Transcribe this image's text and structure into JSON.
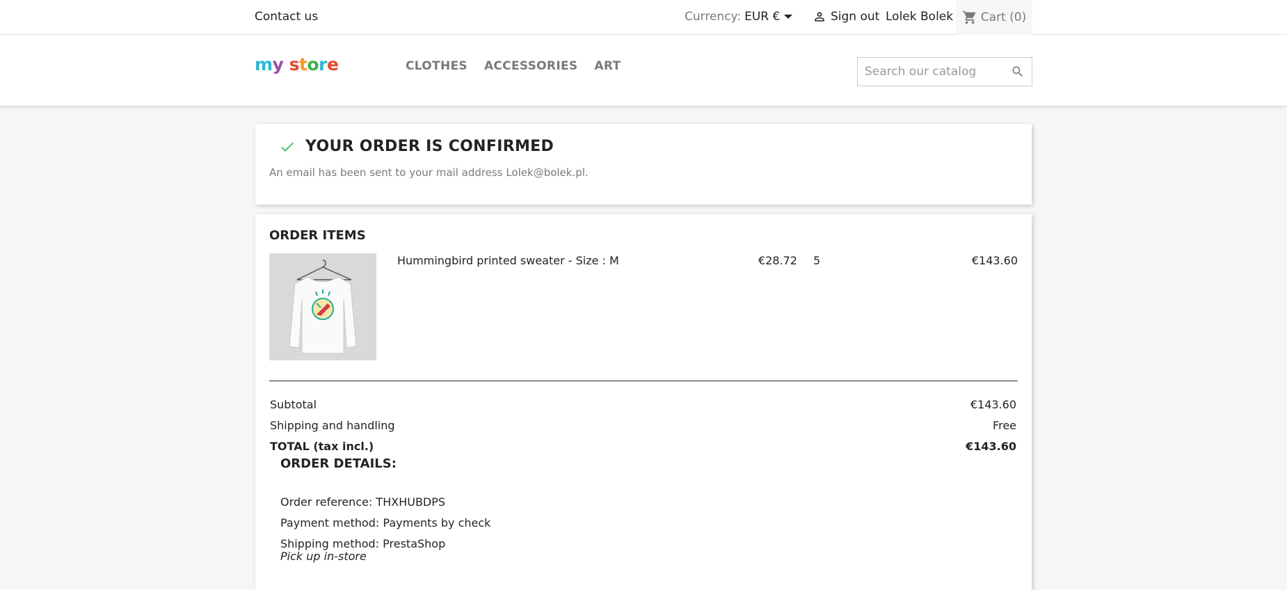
{
  "topbar": {
    "contact": "Contact us",
    "currency_label": "Currency:",
    "currency_value": "EUR €",
    "signout": "Sign out",
    "username": "Lolek Bolek",
    "cart": "Cart (0)"
  },
  "header": {
    "logo": [
      "my",
      " ",
      "s",
      "t",
      "o",
      "r",
      "e"
    ],
    "logo_text": "my store",
    "nav": [
      "CLOTHES",
      "ACCESSORIES",
      "ART"
    ],
    "search_placeholder": "Search our catalog"
  },
  "confirmation": {
    "title": "YOUR ORDER IS CONFIRMED",
    "message": "An email has been sent to your mail address Lolek@bolek.pl."
  },
  "order_items": {
    "heading": "ORDER ITEMS",
    "items": [
      {
        "name": "Hummingbird printed sweater - Size : M",
        "unit_price": "€28.72",
        "quantity": "5",
        "line_total": "€143.60"
      }
    ],
    "subtotal_label": "Subtotal",
    "subtotal_value": "€143.60",
    "shipping_label": "Shipping and handling",
    "shipping_value": "Free",
    "total_label": "TOTAL (tax incl.)",
    "total_value": "€143.60"
  },
  "order_details": {
    "heading": "ORDER DETAILS:",
    "reference": "Order reference: THXHUBDPS",
    "payment": "Payment method: Payments by check",
    "shipping": "Shipping method: PrestaShop",
    "carrier_delay": "Pick up in-store"
  },
  "colors": {
    "accent": "#2fb5d2",
    "check": "#4cbb6c"
  },
  "icons": {
    "user": "person-icon",
    "cart": "shopping-cart-icon",
    "search": "search-icon",
    "check": "check-icon"
  }
}
